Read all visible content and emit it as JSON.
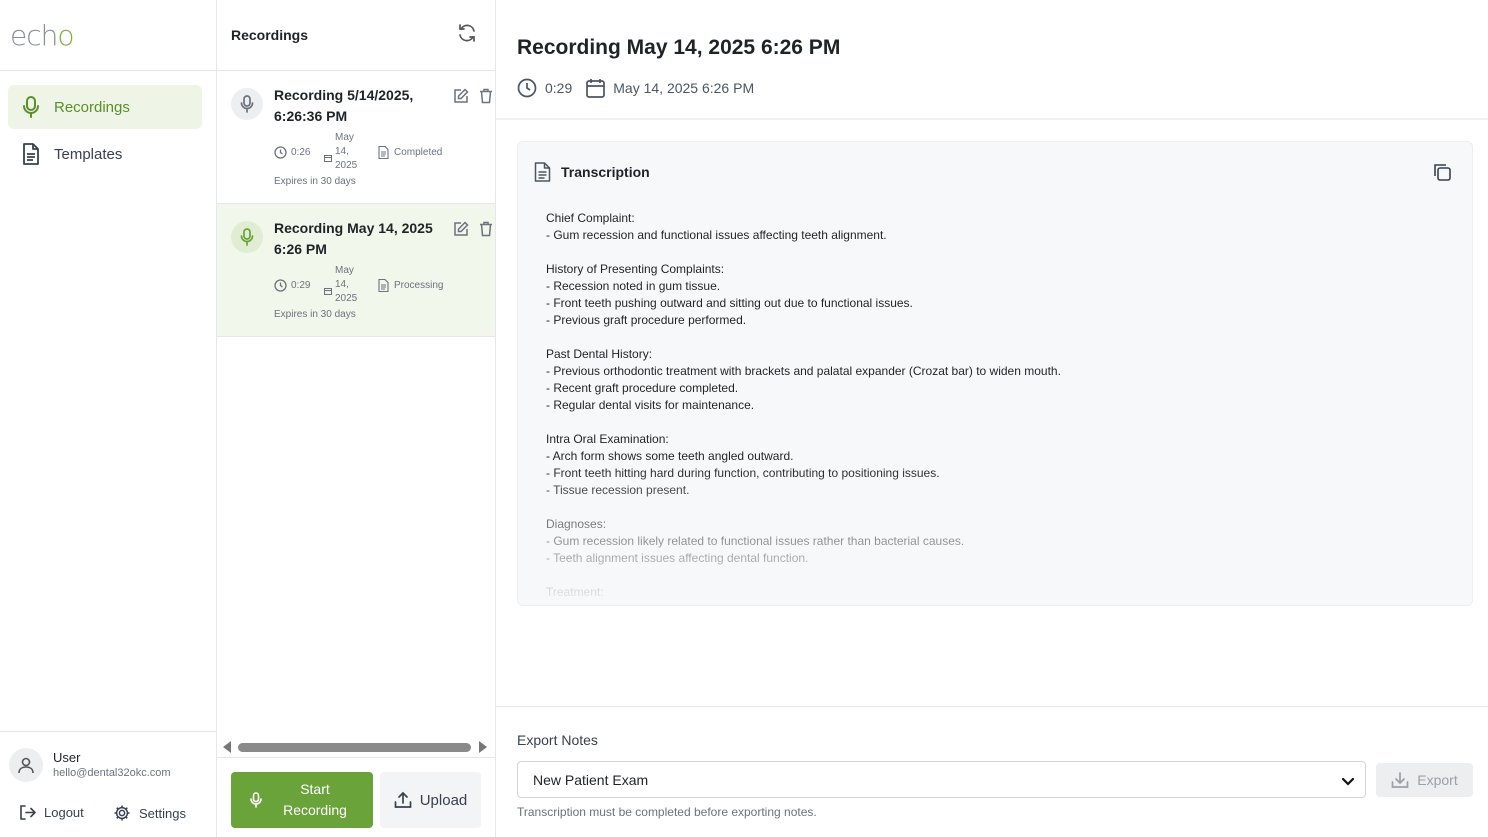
{
  "app": {
    "logo_main": "ech",
    "logo_accent": "o"
  },
  "sidebar": {
    "items": [
      {
        "label": "Recordings",
        "icon": "microphone-icon",
        "active": true
      },
      {
        "label": "Templates",
        "icon": "document-icon",
        "active": false
      }
    ],
    "user": {
      "name": "User",
      "email": "hello@dental32okc.com"
    },
    "logout_label": "Logout",
    "settings_label": "Settings"
  },
  "recordings": {
    "header": "Recordings",
    "items": [
      {
        "title": "Recording 5/14/2025, 6:26:36 PM",
        "date_month": "May",
        "duration": "0:26",
        "date_rest": "14, 2025",
        "status": "Completed",
        "expires": "Expires in 30 days"
      },
      {
        "title": "Recording May 14, 2025 6:26 PM",
        "date_month": "May",
        "duration": "0:29",
        "date_rest": "14, 2025",
        "status": "Processing",
        "expires": "Expires in 30 days"
      }
    ],
    "start_label": "Start Recording",
    "upload_label": "Upload"
  },
  "main": {
    "title": "Recording May 14, 2025 6:26 PM",
    "duration": "0:29",
    "date": "May 14, 2025 6:26 PM",
    "transcription_label": "Transcription",
    "transcript": "Chief Complaint:\n- Gum recession and functional issues affecting teeth alignment.\n\nHistory of Presenting Complaints:\n- Recession noted in gum tissue.\n- Front teeth pushing outward and sitting out due to functional issues.\n- Previous graft procedure performed.\n\nPast Dental History:\n- Previous orthodontic treatment with brackets and palatal expander (Crozat bar) to widen mouth.\n- Recent graft procedure completed.\n- Regular dental visits for maintenance.\n\nIntra Oral Examination:\n- Arch form shows some teeth angled outward.\n- Front teeth hitting hard during function, contributing to positioning issues.\n- Tissue recession present.\n\nDiagnoses:\n- Gum recession likely related to functional issues rather than bacterial causes.\n- Teeth alignment issues affecting dental function.\n\nTreatment:"
  },
  "export": {
    "label": "Export Notes",
    "selected_template": "New Patient Exam",
    "button_label": "Export",
    "note": "Transcription must be completed before exporting notes."
  },
  "colors": {
    "accent": "#6aa33a",
    "accent_light": "#eef4e6"
  }
}
